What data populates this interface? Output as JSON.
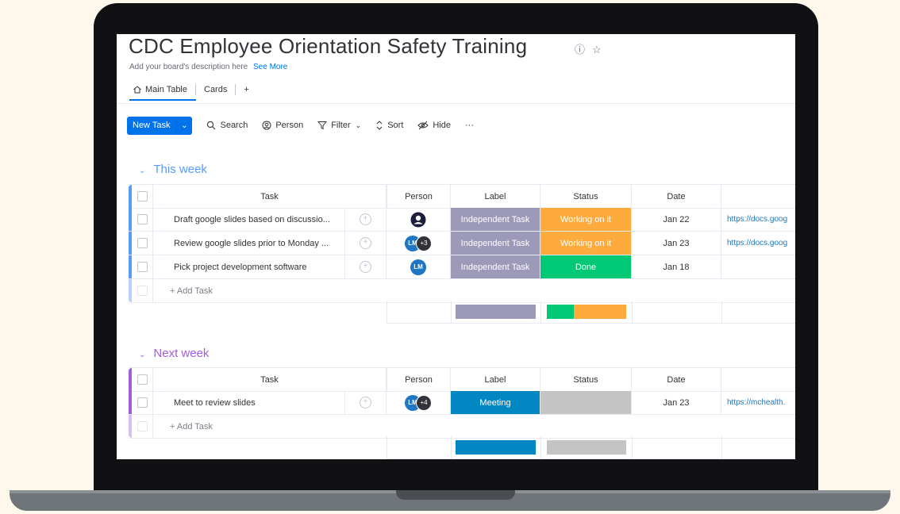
{
  "board": {
    "title": "CDC Employee Orientation Safety Training",
    "description": "Add your board's description here",
    "see_more": "See More"
  },
  "tabs": [
    {
      "label": "Main Table",
      "icon": "home-icon"
    },
    {
      "label": "Cards"
    },
    {
      "label": "+"
    }
  ],
  "toolbar": {
    "new_task": "New Task",
    "search": "Search",
    "person": "Person",
    "filter": "Filter",
    "sort": "Sort",
    "hide": "Hide",
    "more": "···"
  },
  "columns": [
    "Task",
    "Person",
    "Label",
    "Status",
    "Date"
  ],
  "colors": {
    "label_independent": "#9d99b9",
    "label_meeting": "#0086c0",
    "status_working": "#fdab3d",
    "status_done": "#00c875",
    "status_empty": "#c4c4c4",
    "group_this_week": "#579bfc",
    "group_next_week": "#a25ddc"
  },
  "groups": [
    {
      "title": "This week",
      "color": "#579bfc",
      "rows": [
        {
          "task": "Draft google slides based on discussio...",
          "person": "icon",
          "label": "Independent Task",
          "status": "Working on it",
          "date": "Jan 22",
          "link": "https://docs.goog"
        },
        {
          "task": "Review google slides prior to Monday ...",
          "person": "LM",
          "person_more": "+3",
          "label": "Independent Task",
          "status": "Working on it",
          "date": "Jan 23",
          "link": "https://docs.goog"
        },
        {
          "task": "Pick project development software",
          "person": "LM",
          "label": "Independent Task",
          "status": "Done",
          "date": "Jan 18",
          "link": ""
        }
      ],
      "add_task": "+ Add Task"
    },
    {
      "title": "Next week",
      "color": "#a25ddc",
      "rows": [
        {
          "task": "Meet to review slides",
          "person": "LM",
          "person_more": "+4",
          "label": "Meeting",
          "status": "",
          "date": "Jan 23",
          "link": "https://mchealth."
        }
      ],
      "add_task": "+ Add Task"
    }
  ]
}
